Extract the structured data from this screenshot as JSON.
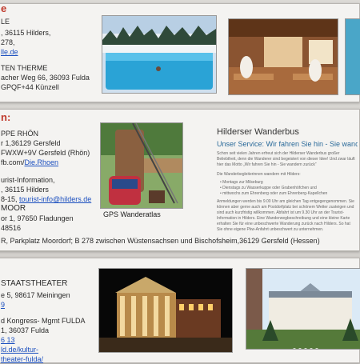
{
  "card1": {
    "heading": "e",
    "lines": [
      "LE",
      ", 36115 Hilders,",
      "278,",
      "lle.de"
    ],
    "therme_title": "TEN THERME",
    "therme_lines": [
      "acher Weg 66, 36093 Fulda",
      "GPQF+44 Künzell"
    ]
  },
  "card2": {
    "heading": "n:",
    "lines": [
      "PPE RHÖN",
      "r 1,36129 Gersfeld",
      "FWXW+9V Gersfeld (Rhön)",
      "fb.com/Die.Rhoen",
      "",
      "urist-Information,",
      ", 36115 Hilders",
      "8-15,",
      "MOOR",
      "or 1, 97650 Fladungen",
      "48516"
    ],
    "email": "tourist-info@hilders.de",
    "fb_link": "fb.com/Die.Rhoen",
    "caption": "GPS  Wanderatlas",
    "bus_title": "Hilderser Wanderbus",
    "bus_subtitle": "Unser Service: Wir fahren Sie hin - Sie wandern zurück",
    "bus_paragraphs": [
      "Schon seit vielen Jahren erfreut sich der Hilderser Wanderbus großer Beliebtheit, denn die Wanderer sind begeistert von dieser Idee! Und zwar läuft hier das Motto „Wir fahren Sie hin - Sie wandern zurück“",
      "Die Wanderbegleiterinnen wandern mit Hilders:",
      "• Montags zur Milseburg",
      "• Dienstags zu Wasserkuppe oder Grabenhöfchen und",
      "• mittwochs zum Ehrenberg oder zum Ehrenberg-Kapellchen",
      "Anmeldungen werden bis 9.00 Uhr am gleichen Tag entgegengenommen. Sie können aber gerne auch am Postdorfplatz bei schönem Wetter zusteigen und sind auch kurzfristig willkommen. Abfahrt ist um 9.30 Uhr an der Tourist-Information in Hilders. Eine Wanderwegbeschreibung und eine kleine Karte erhalten Sie für eine unbeschwerte Wanderung zurück nach Hilders. So hat Sie ohne eigene Pkw-Anfahrt unbeschwert zu unternehmen."
    ],
    "footer": "R, Parkplatz Moordorf; B 278 zwischen Wüstensachsen und Bischofsheim,36129 Gersfeld (Hessen)"
  },
  "card3": {
    "title": "STAATSTHEATER",
    "lines": [
      "e 5, 98617 Meiningen",
      "9",
      "",
      "d Kongress- Mgmt FULDA",
      "1, 36037 Fulda",
      "6 13",
      "ld.de/kultur-",
      "theater-fulda/"
    ]
  },
  "colors": {
    "link": "#1b4fbf",
    "accent": "#c0392b",
    "bus_subtitle": "#2a6a9a"
  }
}
